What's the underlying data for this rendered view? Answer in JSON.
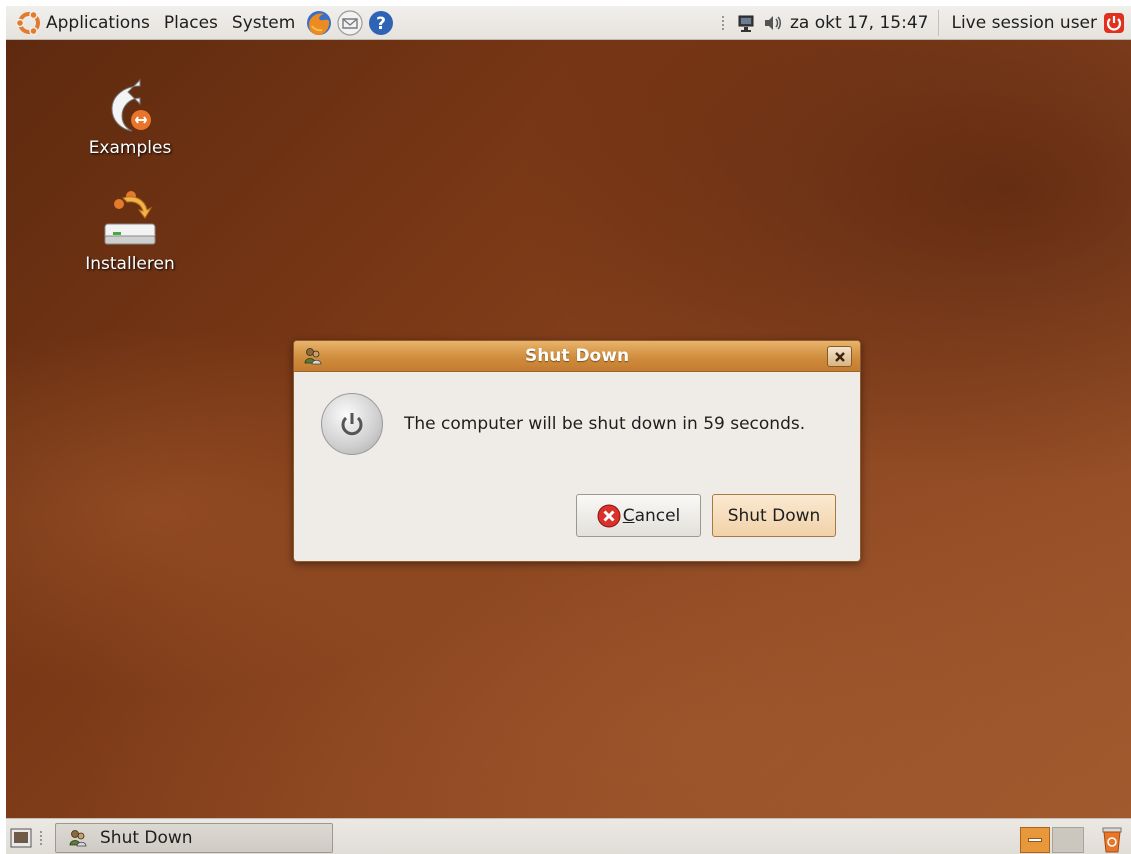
{
  "top_panel": {
    "menus": {
      "applications": "Applications",
      "places": "Places",
      "system": "System"
    },
    "launchers": [
      "firefox-icon",
      "mail-icon",
      "help-icon"
    ],
    "tray_icons": [
      "network-icon",
      "volume-icon"
    ],
    "clock": "za okt 17, 15:47",
    "user": "Live session user"
  },
  "desktop": {
    "icons": [
      {
        "label": "Examples",
        "icon": "examples-folder-icon"
      },
      {
        "label": "Installeren",
        "icon": "install-icon"
      }
    ]
  },
  "dialog": {
    "title": "Shut Down",
    "message": "The computer will be shut down in 59 seconds.",
    "cancel_accel": "C",
    "cancel_rest": "ancel",
    "confirm_label": "Shut Down"
  },
  "bottom_panel": {
    "task_label": "Shut Down"
  },
  "colors": {
    "accent": "#d08d3e",
    "desktop_dark": "#5e2a0f",
    "desktop_light": "#a0582d"
  }
}
